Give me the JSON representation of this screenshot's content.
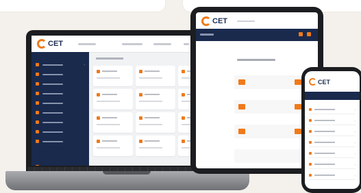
{
  "brand": {
    "logo_text": "CET",
    "accent": "#f07a1a",
    "navy": "#1a2a4d"
  },
  "laptop": {
    "sidebar_items": [
      {
        "icon": "home-icon"
      },
      {
        "icon": "file-icon"
      },
      {
        "icon": "chart-icon"
      },
      {
        "icon": "users-icon"
      },
      {
        "icon": "calendar-icon"
      },
      {
        "icon": "clipboard-icon"
      },
      {
        "icon": "settings-icon"
      },
      {
        "icon": "bell-icon"
      },
      {
        "icon": "help-icon"
      }
    ],
    "tiles_count": 12
  },
  "tablet": {
    "logo_text": "CET"
  },
  "phone": {
    "logo_text": "CET",
    "menu_items": 8
  }
}
